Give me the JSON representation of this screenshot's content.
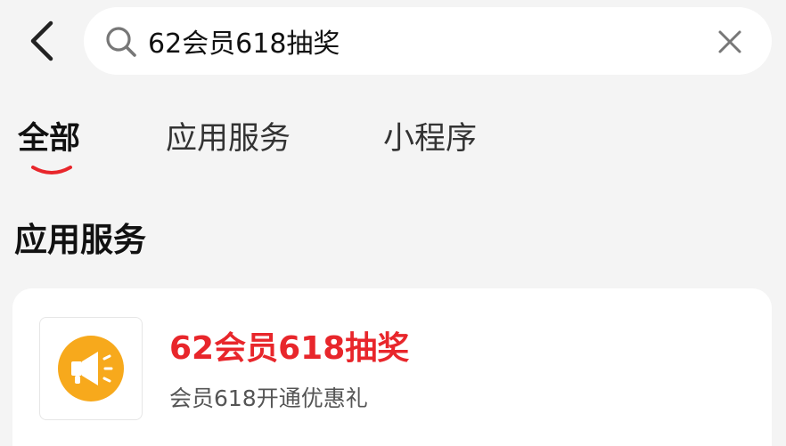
{
  "header": {
    "back_icon": "chevron-left-icon",
    "search": {
      "icon": "search-icon",
      "value": "62会员618抽奖",
      "clear_icon": "close-icon"
    }
  },
  "tabs": [
    {
      "label": "全部",
      "active": true
    },
    {
      "label": "应用服务",
      "active": false
    },
    {
      "label": "小程序",
      "active": false
    }
  ],
  "colors": {
    "accent": "#e8262b",
    "background": "#f4f4f4",
    "card": "#ffffff",
    "icon_orange": "#f7a91c"
  },
  "section": {
    "title": "应用服务"
  },
  "results": [
    {
      "icon": "megaphone-icon",
      "title": "62会员618抽奖",
      "subtitle": "会员618开通优惠礼"
    }
  ]
}
